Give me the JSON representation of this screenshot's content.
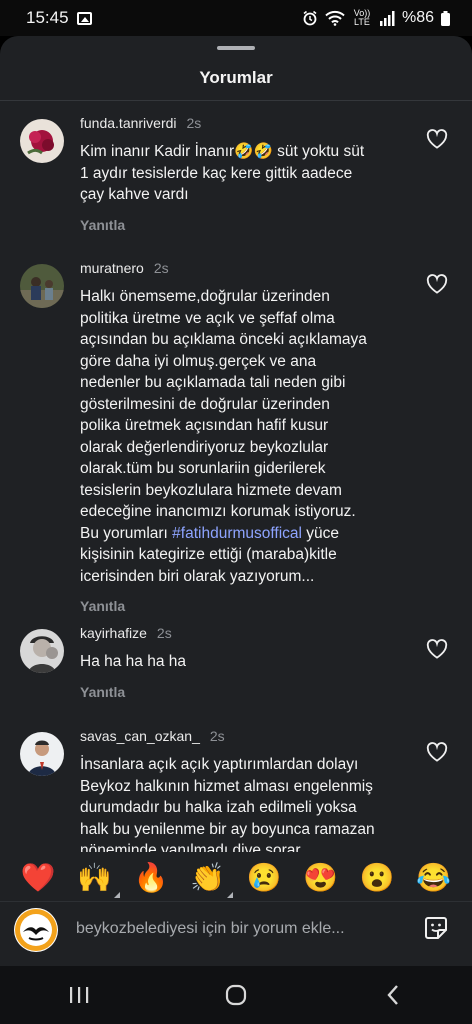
{
  "status_bar": {
    "time": "15:45",
    "volte": "Vo)) LTE",
    "battery": "%86"
  },
  "sheet": {
    "title": "Yorumlar"
  },
  "comments": [
    {
      "username": "funda.tanriverdi",
      "time": "2s",
      "text": "Kim inanır Kadir İnanır🤣🤣 süt yoktu süt\n1 aydır tesislerde kaç kere gittik aadece\nçay kahve vardı",
      "reply": "Yanıtla"
    },
    {
      "username": "muratnero",
      "time": "2s",
      "text_before_tag": "Halkı önemseme,doğrular üzerinden\npolitika üretme ve açık ve şeffaf olma\naçısından bu açıklama önceki açıklamaya\ngöre daha iyi olmuş.gerçek ve ana\nnedenler bu açıklamada tali neden gibi\ngösterilmesini de doğrular üzerinden\npolika üretmek açısından hafif kusur\nolarak değerlendiriyoruz beykozlular\nolarak.tüm bu sorunlariin giderilerek\ntesislerin beykozlulara hizmete devam\nedeceğine inancımızı korumak istiyoruz.\nBu yorumları ",
      "tag": "#fatihdurmusoffical",
      "text_after_tag": " yüce\nkişisinin kategirize ettiği (maraba)kitle\nicerisinden biri olarak yazıyorum...",
      "reply": "Yanıtla"
    },
    {
      "username": "kayirhafize",
      "time": "2s",
      "text": "Ha ha ha ha ha",
      "reply": "Yanıtla"
    },
    {
      "username": "savas_can_ozkan_",
      "time": "2s",
      "text": "İnsanlara açık açık yaptırımlardan dolayı\nBeykoz halkının hizmet alması engelenmiş\ndurumdadır bu halka izah edilmeli yoksa\nhalk bu yenilenme bir ay boyunca ramazan\nnöneminde yanılmadı dive sorar"
    }
  ],
  "emojis": [
    "❤️",
    "🙌",
    "🔥",
    "👏",
    "😢",
    "😍",
    "😮",
    "😂"
  ],
  "input": {
    "placeholder": "beykozbelediyesi için bir yorum ekle..."
  },
  "colors": {
    "sheet_bg": "#1f2124",
    "hashtag": "#8ea4ff",
    "muted": "#8e9196"
  }
}
